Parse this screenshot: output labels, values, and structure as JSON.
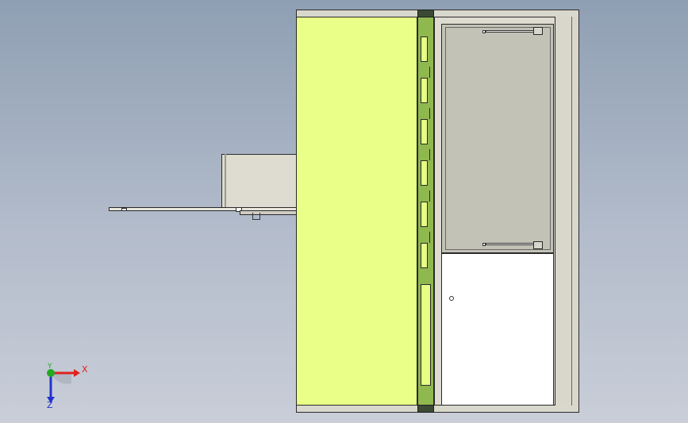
{
  "triad": {
    "x_label": "X",
    "y_label": "Y",
    "z_label": "Z",
    "x_color": "#e02020",
    "y_color": "#22aa22",
    "z_color": "#2233cc"
  },
  "model": {
    "panel_color": "#eaff88",
    "strip_color": "#8fb84f",
    "glass_color": "#c3c2b6",
    "door_color": "#ffffff"
  }
}
